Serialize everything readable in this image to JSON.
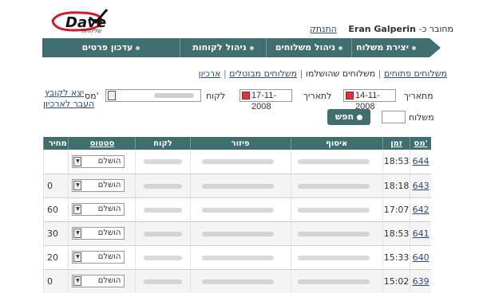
{
  "brand": {
    "name": "Dave",
    "tagline": "שליחויות"
  },
  "user": {
    "prefix": "מחובר כ-",
    "name": "Eran Galperin",
    "logout": "התנתק"
  },
  "nav": {
    "main": "משלוחים",
    "items": [
      "יצירת משלוח",
      "ניהול משלוחים",
      "ניהול לקוחות",
      "עדכון פרטים"
    ]
  },
  "subtabs": {
    "pending": "משלוחים פתוחים",
    "done": "משלוחים שהושלמו",
    "cancelled": "משלוחים מבוטלים",
    "archive": "ארכיון"
  },
  "filters": {
    "from_label": "מתאריך",
    "from_value": "14-11-2008",
    "to_label": "לתאריך",
    "to_value": "17-11-2008",
    "customer_label": "לקוח",
    "num_label": "מס'",
    "export_link": "יצא לקובץ",
    "archive_link": "העבר לארכיון",
    "shipment_label": "משלוח",
    "search_button": "חפש"
  },
  "table": {
    "headers": {
      "num": "מס'",
      "time": "זמן",
      "pickup": "איסוף",
      "dest": "פיזור",
      "customer": "לקוח",
      "status": "סטטוס",
      "price": "מחיר"
    },
    "rows": [
      {
        "num": "644",
        "time": "18:53",
        "status": "הושלם",
        "price": ""
      },
      {
        "num": "643",
        "time": "18:18",
        "status": "הושלם",
        "price": "0"
      },
      {
        "num": "642",
        "time": "17:07",
        "status": "הושלם",
        "price": "60"
      },
      {
        "num": "641",
        "time": "18:53",
        "status": "הושלם",
        "price": "30"
      },
      {
        "num": "640",
        "time": "15:33",
        "status": "הושלם",
        "price": "20"
      },
      {
        "num": "639",
        "time": "15:02",
        "status": "הושלם",
        "price": "0"
      }
    ]
  }
}
